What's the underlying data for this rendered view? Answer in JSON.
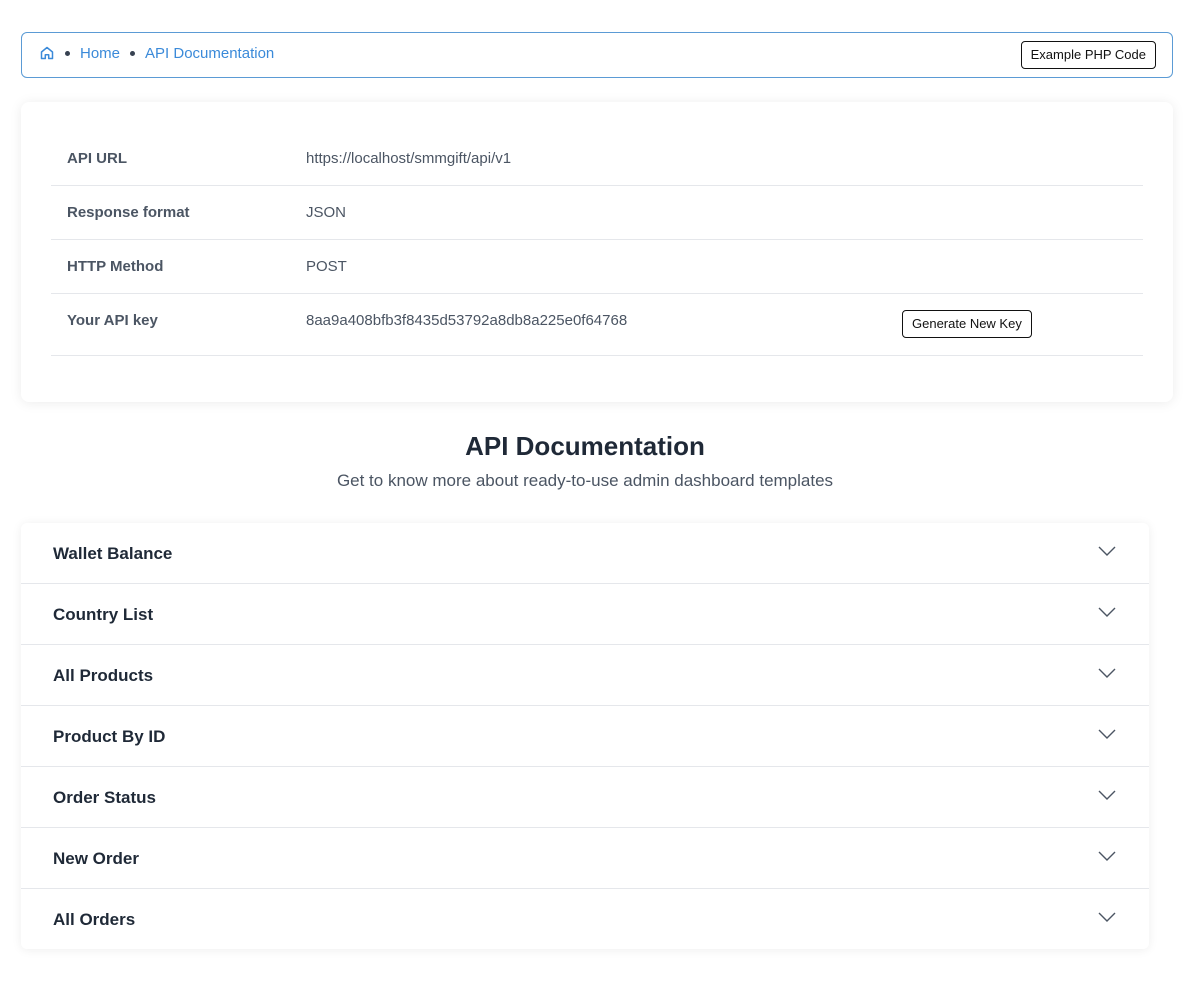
{
  "breadcrumb": {
    "home_icon": "home-icon",
    "items": [
      "Home",
      "API Documentation"
    ],
    "action_label": "Example PHP Code"
  },
  "info": {
    "rows": [
      {
        "label": "API URL",
        "value": "https://localhost/smmgift/api/v1"
      },
      {
        "label": "Response format",
        "value": "JSON"
      },
      {
        "label": "HTTP Method",
        "value": "POST"
      },
      {
        "label": "Your API key",
        "value": "8aa9a408bfb3f8435d53792a8db8a225e0f64768"
      }
    ],
    "generate_label": "Generate New Key"
  },
  "docs": {
    "title": "API Documentation",
    "subtitle": "Get to know more about ready-to-use admin dashboard templates"
  },
  "accordion": {
    "chevron_icon": "chevron-down-icon",
    "items": [
      "Wallet Balance",
      "Country List",
      "All Products",
      "Product By ID",
      "Order Status",
      "New Order",
      "All Orders"
    ]
  },
  "colors": {
    "accent": "#3b8ad9",
    "border_accent": "#5b9bd5"
  }
}
